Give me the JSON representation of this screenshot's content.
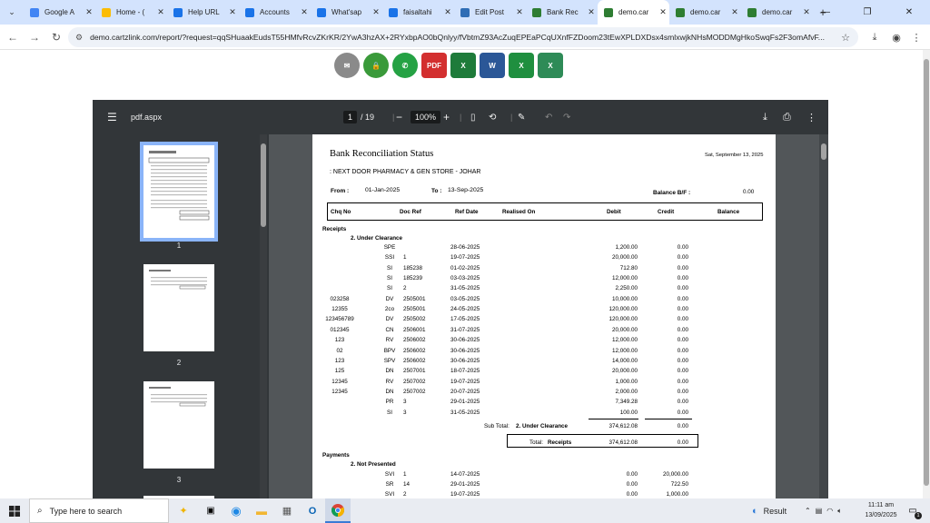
{
  "browser": {
    "tabs": [
      {
        "title": "Google A",
        "color": "#4285f4"
      },
      {
        "title": "Home - (",
        "color": "#fbbc04"
      },
      {
        "title": "Help URL",
        "color": "#1a73e8"
      },
      {
        "title": "Accounts",
        "color": "#1a73e8"
      },
      {
        "title": "What'sap",
        "color": "#1a73e8"
      },
      {
        "title": "faisaltahi",
        "color": "#1a73e8"
      },
      {
        "title": "Edit Post",
        "color": "#2f6db5"
      },
      {
        "title": "Bank Rec",
        "color": "#2e7d32"
      },
      {
        "title": "demo.car",
        "color": "#2e7d32",
        "active": true
      },
      {
        "title": "demo.car",
        "color": "#2e7d32"
      },
      {
        "title": "demo.car",
        "color": "#2e7d32"
      }
    ],
    "url": "demo.cartzlink.com/report/?request=qqSHuaakEudsT55HMfvRcvZKrKR/2YwA3hzAX+2RYxbpAO0bQnlyy/fVbtmZ93AcZuqEPEaPCqUXnfFZDoom23tEwXPLDXDsx4smlxwjkNHsMODDMgHkoSwqFs2F3omAfvF..."
  },
  "export_icons": [
    "email-icon",
    "lock-icon",
    "whatsapp-icon",
    "pdf-icon",
    "excel-icon",
    "word-icon",
    "excel-data-icon",
    "excel-alt-icon"
  ],
  "pdf": {
    "filename": "pdf.aspx",
    "page_current": "1",
    "page_total": "/ 19",
    "zoom": "100%",
    "thumb_labels": [
      "1",
      "2",
      "3"
    ]
  },
  "report": {
    "title": "Bank Reconciliation Status",
    "date": "Sat, September 13, 2025",
    "company": ": NEXT DOOR PHARMACY & GEN STORE - JOHAR",
    "from_label": "From :",
    "from_value": "01-Jan-2025",
    "to_label": "To :",
    "to_value": "13-Sep-2025",
    "balance_bf_label": "Balance B/F :",
    "balance_bf_value": "0.00",
    "columns": [
      "Chq No",
      "Doc Ref",
      "Ref Date",
      "Realised On",
      "Debit",
      "Credit",
      "Balance"
    ],
    "receipts_label": "Receipts",
    "under_clearance_label": "2. Under Clearance",
    "receipts_rows": [
      {
        "chq": "",
        "type": "SPE",
        "doc": "",
        "date": "28-06-2025",
        "debit": "1,200.00",
        "credit": "0.00"
      },
      {
        "chq": "",
        "type": "SSI",
        "doc": "1",
        "date": "19-07-2025",
        "debit": "20,000.00",
        "credit": "0.00"
      },
      {
        "chq": "",
        "type": "SI",
        "doc": "185238",
        "date": "01-02-2025",
        "debit": "712.80",
        "credit": "0.00"
      },
      {
        "chq": "",
        "type": "SI",
        "doc": "185239",
        "date": "03-03-2025",
        "debit": "12,000.00",
        "credit": "0.00"
      },
      {
        "chq": "",
        "type": "SI",
        "doc": "2",
        "date": "31-05-2025",
        "debit": "2,250.00",
        "credit": "0.00"
      },
      {
        "chq": "023258",
        "type": "DV",
        "doc": "2505001",
        "date": "03-05-2025",
        "debit": "10,000.00",
        "credit": "0.00"
      },
      {
        "chq": "12355",
        "type": "2co",
        "doc": "2505001",
        "date": "24-05-2025",
        "debit": "120,000.00",
        "credit": "0.00"
      },
      {
        "chq": "123456789",
        "type": "DV",
        "doc": "2505002",
        "date": "17-05-2025",
        "debit": "120,000.00",
        "credit": "0.00"
      },
      {
        "chq": "012345",
        "type": "CN",
        "doc": "2506001",
        "date": "31-07-2025",
        "debit": "20,000.00",
        "credit": "0.00"
      },
      {
        "chq": "123",
        "type": "RV",
        "doc": "2506002",
        "date": "30-06-2025",
        "debit": "12,000.00",
        "credit": "0.00"
      },
      {
        "chq": "02",
        "type": "BPV",
        "doc": "2506002",
        "date": "30-06-2025",
        "debit": "12,000.00",
        "credit": "0.00"
      },
      {
        "chq": "123",
        "type": "SPV",
        "doc": "2506002",
        "date": "30-06-2025",
        "debit": "14,000.00",
        "credit": "0.00"
      },
      {
        "chq": "125",
        "type": "DN",
        "doc": "2507001",
        "date": "18-07-2025",
        "debit": "20,000.00",
        "credit": "0.00"
      },
      {
        "chq": "12345",
        "type": "RV",
        "doc": "2507002",
        "date": "19-07-2025",
        "debit": "1,000.00",
        "credit": "0.00"
      },
      {
        "chq": "12345",
        "type": "DN",
        "doc": "2507002",
        "date": "20-07-2025",
        "debit": "2,000.00",
        "credit": "0.00"
      },
      {
        "chq": "",
        "type": "PR",
        "doc": "3",
        "date": "29-01-2025",
        "debit": "7,349.28",
        "credit": "0.00"
      },
      {
        "chq": "",
        "type": "SI",
        "doc": "3",
        "date": "31-05-2025",
        "debit": "100.00",
        "credit": "0.00"
      }
    ],
    "subtotal_label": "Sub Total:",
    "subtotal_name": "2. Under Clearance",
    "subtotal_debit": "374,612.08",
    "subtotal_credit": "0.00",
    "total_label": "Total:",
    "total_name": "Receipts",
    "total_debit": "374,612.08",
    "total_credit": "0.00",
    "payments_label": "Payments",
    "not_presented_label": "2. Not Presented",
    "payments_rows": [
      {
        "chq": "",
        "type": "SVI",
        "doc": "1",
        "date": "14-07-2025",
        "debit": "0.00",
        "credit": "20,000.00"
      },
      {
        "chq": "",
        "type": "SR",
        "doc": "14",
        "date": "29-01-2025",
        "debit": "0.00",
        "credit": "722.50"
      },
      {
        "chq": "",
        "type": "SVI",
        "doc": "2",
        "date": "19-07-2025",
        "debit": "0.00",
        "credit": "1,000.00"
      }
    ]
  },
  "taskbar": {
    "search_placeholder": "Type here to search",
    "weather": "Result",
    "time": "11:11 am",
    "date": "13/09/2025",
    "notif_count": "1"
  }
}
